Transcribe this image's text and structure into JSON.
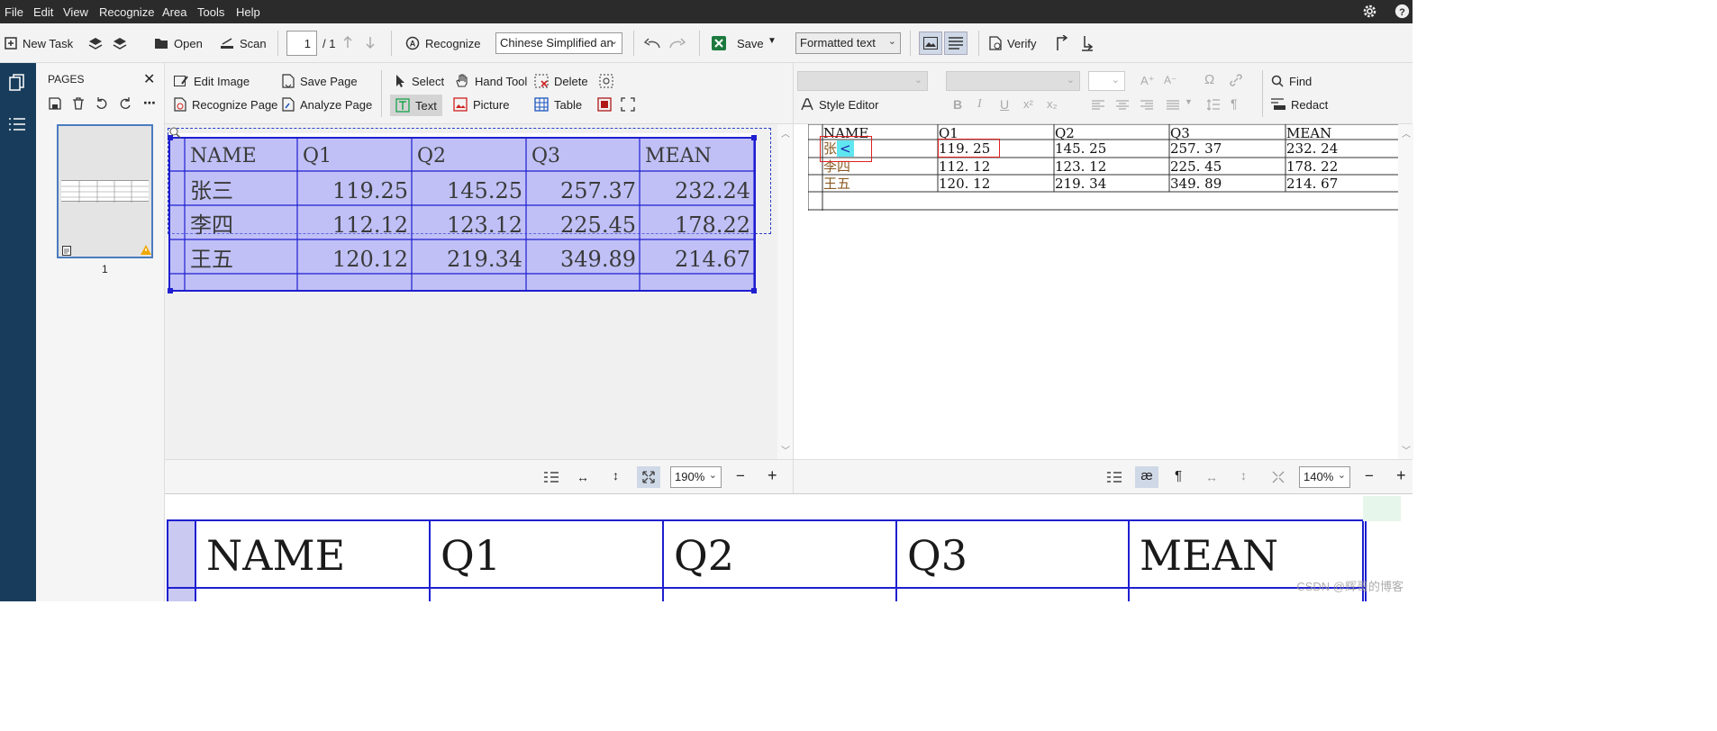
{
  "menu": [
    "File",
    "Edit",
    "View",
    "Recognize",
    "Area",
    "Tools",
    "Help"
  ],
  "toolbar": {
    "new_task": "New Task",
    "open": "Open",
    "scan": "Scan",
    "page_number": "1",
    "page_total": "/ 1",
    "recognize": "Recognize",
    "language": "Chinese Simplified an",
    "save": "Save",
    "output_format": "Formatted text",
    "verify": "Verify"
  },
  "pages_panel": {
    "title": "PAGES",
    "thumbnail_label": "1"
  },
  "image_tools": {
    "edit_image": "Edit Image",
    "save_page": "Save Page",
    "select": "Select",
    "hand_tool": "Hand Tool",
    "delete": "Delete",
    "recognize_page": "Recognize Page",
    "analyze_page": "Analyze Page",
    "text": "Text",
    "picture": "Picture",
    "table": "Table"
  },
  "text_tools": {
    "style_editor": "Style Editor",
    "find": "Find",
    "redact": "Redact"
  },
  "image_table": {
    "headers": [
      "NAME",
      "Q1",
      "Q2",
      "Q3",
      "MEAN"
    ],
    "rows": [
      [
        "张三",
        "119.25",
        "145.25",
        "257.37",
        "232.24"
      ],
      [
        "李四",
        "112.12",
        "123.12",
        "225.45",
        "178.22"
      ],
      [
        "王五",
        "120.12",
        "219.34",
        "349.89",
        "214.67"
      ]
    ]
  },
  "text_table": {
    "headers": [
      "NAME",
      "Q1",
      "Q2",
      "Q3",
      "MEAN"
    ],
    "rows": [
      [
        "张<",
        "119. 25",
        "145. 25",
        "257. 37",
        "232. 24"
      ],
      [
        "李四",
        "112. 12",
        "123. 12",
        "225. 45",
        "178. 22"
      ],
      [
        "王五",
        "120. 12",
        "219. 34",
        "349. 89",
        "214. 67"
      ]
    ],
    "first_cell_prefix": "张",
    "first_cell_suffix": "<"
  },
  "zoom": {
    "left_zoom": "190%",
    "right_zoom": "140%"
  },
  "zoom_table": {
    "headers": [
      "NAME",
      "Q1",
      "Q2",
      "Q3",
      "MEAN"
    ]
  },
  "watermark": "CSDN @辉哥的博客",
  "colors": {
    "menubar": "#2b2b2b",
    "leftbar": "#183d5c",
    "selection_fill": "#b9b9f7",
    "selection_border": "#1f1fd0",
    "error_highlight": "#e02020",
    "cyan_highlight": "#5fe6f0"
  }
}
